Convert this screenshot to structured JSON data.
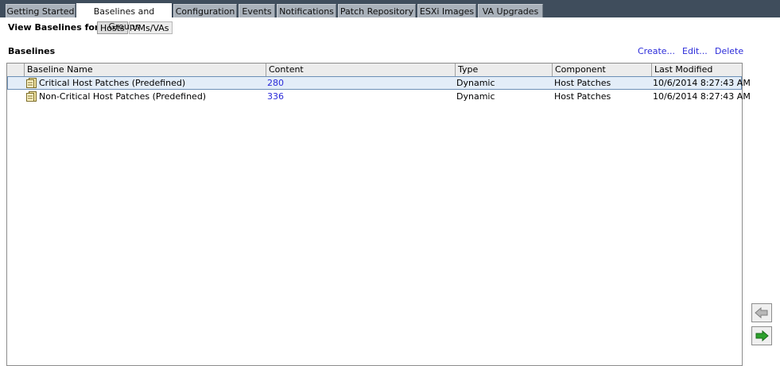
{
  "tabs": [
    {
      "label": "Getting Started",
      "active": false
    },
    {
      "label": "Baselines and Groups",
      "active": true
    },
    {
      "label": "Configuration",
      "active": false
    },
    {
      "label": "Events",
      "active": false
    },
    {
      "label": "Notifications",
      "active": false
    },
    {
      "label": "Patch Repository",
      "active": false
    },
    {
      "label": "ESXi Images",
      "active": false
    },
    {
      "label": "VA Upgrades",
      "active": false
    }
  ],
  "view": {
    "label": "View Baselines for:",
    "hosts_label": "Hosts",
    "vms_label": "VMs/VAs",
    "selected": "Hosts"
  },
  "baselines": {
    "title": "Baselines",
    "actions": {
      "create": "Create...",
      "edit": "Edit...",
      "delete": "Delete"
    },
    "columns": [
      "Baseline Name",
      "Content",
      "Type",
      "Component",
      "Last Modified"
    ],
    "rows": [
      {
        "name": "Critical Host Patches (Predefined)",
        "content": "280",
        "type": "Dynamic",
        "component": "Host Patches",
        "modified": "10/6/2014 8:27:43 AM",
        "selected": true
      },
      {
        "name": "Non-Critical Host Patches (Predefined)",
        "content": "336",
        "type": "Dynamic",
        "component": "Host Patches",
        "modified": "10/6/2014 8:27:43 AM",
        "selected": false
      }
    ]
  },
  "icons": {
    "baseline": "baseline-icon",
    "left_arrow": "arrow-left-icon",
    "right_arrow": "arrow-right-icon"
  },
  "colors": {
    "tabstrip": "#3f4d5c",
    "link": "#2b2bd9",
    "selected_row": "#e3edf8",
    "green_arrow": "#2ca02c"
  }
}
